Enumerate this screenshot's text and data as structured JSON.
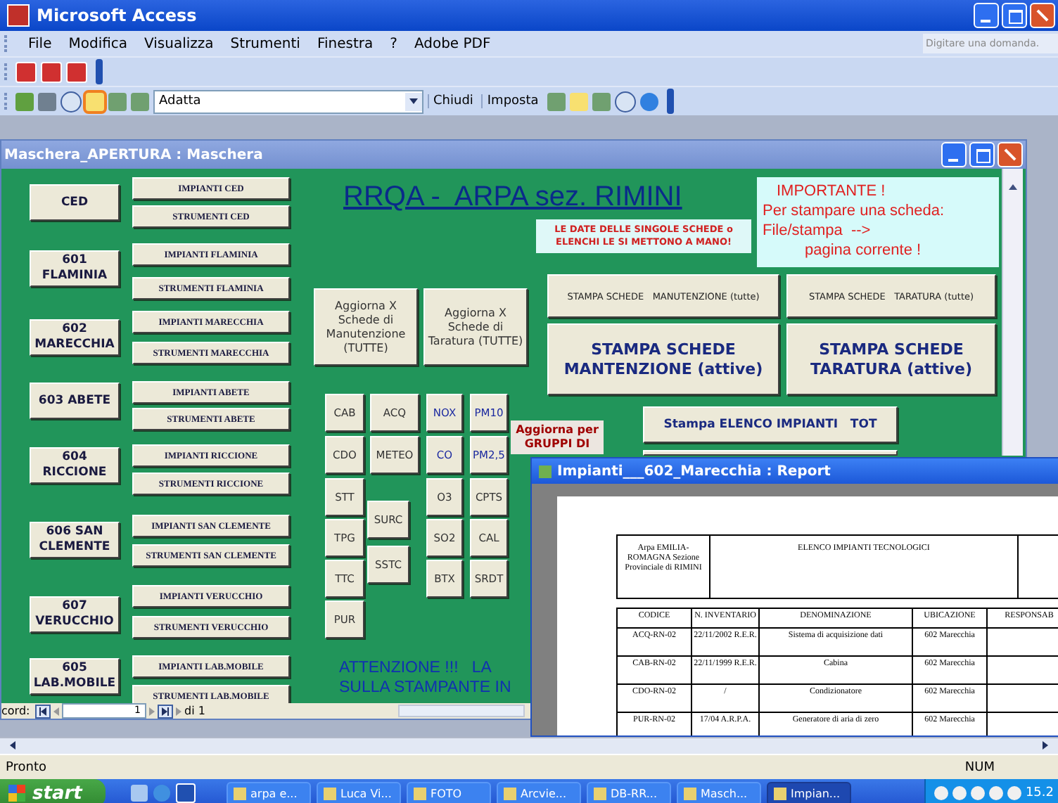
{
  "app_window": {
    "title": "Microsoft Access"
  },
  "menu": [
    "File",
    "Modifica",
    "Visualizza",
    "Strumenti",
    "Finestra",
    "?",
    "Adobe PDF"
  ],
  "help_search": {
    "placeholder": "Digitare una domanda."
  },
  "toolbar": {
    "zoom_value": "Adatta",
    "buttons": [
      "Chiudi",
      "Imposta"
    ]
  },
  "form_window": {
    "title": "Maschera_APERTURA : Maschera",
    "heading": "RRQA -  ARPA sez. RIMINI",
    "date_note": "LE DATE DELLE SINGOLE SCHEDE o ELENCHI LE SI METTONO A MANO!",
    "important_note": [
      "IMPORTANTE !",
      "Per stampare una scheda:",
      "File/stampa  -->",
      "pagina corrente !"
    ],
    "stations": [
      {
        "name": "CED",
        "impianti": "IMPIANTI CED",
        "strumenti": "STRUMENTI CED"
      },
      {
        "name": "601 FLAMINIA",
        "impianti": "IMPIANTI FLAMINIA",
        "strumenti": "STRUMENTI FLAMINIA"
      },
      {
        "name": "602 MARECCHIA",
        "impianti": "IMPIANTI MARECCHIA",
        "strumenti": "STRUMENTI MARECCHIA"
      },
      {
        "name": "603 ABETE",
        "impianti": "IMPIANTI ABETE",
        "strumenti": "STRUMENTI ABETE"
      },
      {
        "name": "604 RICCIONE",
        "impianti": "IMPIANTI RICCIONE",
        "strumenti": "STRUMENTI RICCIONE"
      },
      {
        "name": "606 SAN CLEMENTE",
        "impianti": "IMPIANTI SAN CLEMENTE",
        "strumenti": "STRUMENTI SAN CLEMENTE"
      },
      {
        "name": "607 VERUCCHIO",
        "impianti": "IMPIANTI VERUCCHIO",
        "strumenti": "STRUMENTI VERUCCHIO"
      },
      {
        "name": "605 LAB.MOBILE",
        "impianti": "IMPIANTI LAB.MOBILE",
        "strumenti": "STRUMENTI LAB.MOBILE"
      }
    ],
    "update_buttons": [
      "Aggiorna X Schede di Manutenzione (TUTTE)",
      "Aggiorna X Schede di Taratura (TUTTE)"
    ],
    "print_buttons": [
      {
        "label": "STAMPA SCHEDE   MANUTENZIONE (tutte)",
        "kind": "small"
      },
      {
        "label": "STAMPA SCHEDE   TARATURA (tutte)",
        "kind": "small"
      },
      {
        "label": "STAMPA SCHEDE MANTENZIONE (attive)",
        "kind": "large"
      },
      {
        "label": "STAMPA SCHEDE TARATURA (attive)",
        "kind": "large"
      }
    ],
    "list_button": "Stampa ELENCO IMPIANTI   TOT",
    "group_update_button": "Aggiorna per GRUPPI DI",
    "instrument_buttons": [
      {
        "label": "CAB",
        "kind": "plain"
      },
      {
        "label": "ACQ",
        "kind": "plain"
      },
      {
        "label": "NOX",
        "kind": "gas"
      },
      {
        "label": "PM10",
        "kind": "gas"
      },
      {
        "label": "CDO",
        "kind": "plain"
      },
      {
        "label": "METEO",
        "kind": "plain"
      },
      {
        "label": "CO",
        "kind": "gas"
      },
      {
        "label": "PM2,5",
        "kind": "gas"
      },
      {
        "label": "STT",
        "kind": "plain"
      },
      {
        "label": "O3",
        "kind": "plain"
      },
      {
        "label": "CPTS",
        "kind": "plain"
      },
      {
        "label": "SURC",
        "kind": "plain"
      },
      {
        "label": "TPG",
        "kind": "plain"
      },
      {
        "label": "SO2",
        "kind": "plain"
      },
      {
        "label": "CAL",
        "kind": "plain"
      },
      {
        "label": "SSTC",
        "kind": "plain"
      },
      {
        "label": "TTC",
        "kind": "plain"
      },
      {
        "label": "BTX",
        "kind": "plain"
      },
      {
        "label": "SRDT",
        "kind": "plain"
      },
      {
        "label": "PUR",
        "kind": "plain"
      }
    ],
    "warning": [
      "ATTENZIONE !!!   LA",
      "SULLA STAMPANTE IN"
    ],
    "record_nav": {
      "label": "cord:",
      "value": "1",
      "total": "di 1"
    }
  },
  "report_window": {
    "title": "Impianti___602_Marecchia : Report",
    "org": "Arpa EMILIA-ROMAGNA Sezione Provinciale di RIMINI",
    "report_title": "ELENCO IMPIANTI TECNOLOGICI",
    "columns": [
      "CODICE",
      "N. INVENTARIO",
      "DENOMINAZIONE",
      "UBICAZIONE",
      "RESPONSAB"
    ],
    "rows": [
      [
        "ACQ-RN-02",
        "22/11/2002 R.E.R.",
        "Sistema di acquisizione dati",
        "602 Marecchia"
      ],
      [
        "CAB-RN-02",
        "22/11/1999 R.E.R.",
        "Cabina",
        "602 Marecchia"
      ],
      [
        "CDO-RN-02",
        "/",
        "Condizionatore",
        "602 Marecchia"
      ],
      [
        "PUR-RN-02",
        "17/04 A.R.P.A.",
        "Generatore di aria di zero",
        "602 Marecchia"
      ]
    ]
  },
  "status_bar": {
    "text": "Pronto",
    "indicator": "NUM"
  },
  "taskbar": {
    "start": "start",
    "tasks": [
      {
        "label": "arpa e...",
        "selected": false
      },
      {
        "label": "Luca Vi...",
        "selected": false
      },
      {
        "label": "FOTO",
        "selected": false
      },
      {
        "label": "Arcvie...",
        "selected": false
      },
      {
        "label": "DB-RR...",
        "selected": false
      },
      {
        "label": "Masch...",
        "selected": false
      },
      {
        "label": "Impian...",
        "selected": true
      }
    ],
    "clock": "15.2"
  }
}
